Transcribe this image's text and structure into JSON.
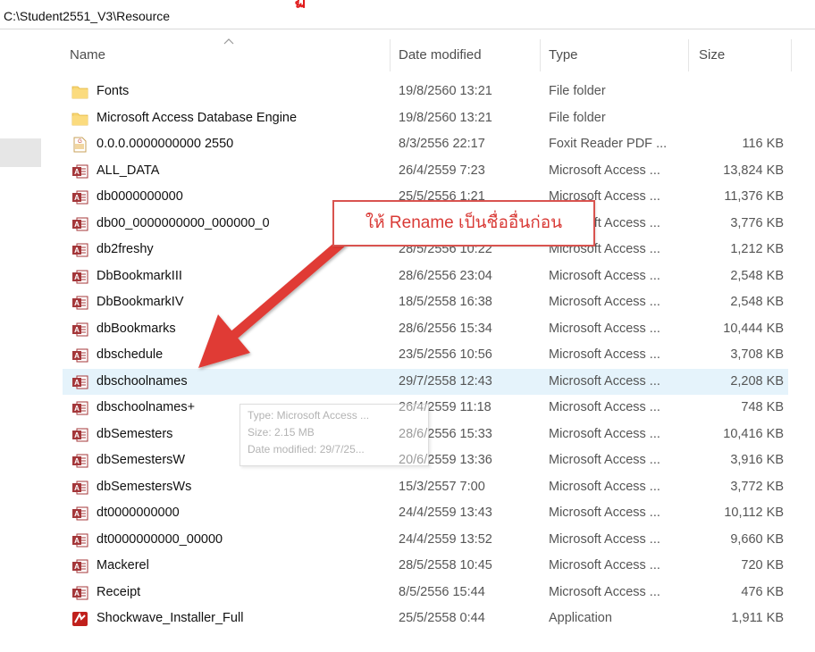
{
  "window": {
    "path": "C:\\Student2551_V3\\Resource",
    "top_red_text": "ฏ"
  },
  "columns": {
    "name": "Name",
    "date": "Date modified",
    "type": "Type",
    "size": "Size"
  },
  "files": [
    {
      "name": "Fonts",
      "date": "19/8/2560 13:21",
      "type": "File folder",
      "size": "",
      "icon": "folder-icon"
    },
    {
      "name": "Microsoft Access Database Engine",
      "date": "19/8/2560 13:21",
      "type": "File folder",
      "size": "",
      "icon": "folder-icon"
    },
    {
      "name": "0.0.0.0000000000 2550",
      "date": "8/3/2556 22:17",
      "type": "Foxit Reader PDF ...",
      "size": "116 KB",
      "icon": "pdf-icon"
    },
    {
      "name": "ALL_DATA",
      "date": "26/4/2559 7:23",
      "type": "Microsoft Access ...",
      "size": "13,824 KB",
      "icon": "access-icon"
    },
    {
      "name": "db0000000000",
      "date": "25/5/2556 1:21",
      "type": "Microsoft Access ...",
      "size": "11,376 KB",
      "icon": "access-icon"
    },
    {
      "name": "db00_0000000000_000000_0",
      "date": "",
      "type": "Microsoft Access ...",
      "size": "3,776 KB",
      "icon": "access-icon"
    },
    {
      "name": "db2freshy",
      "date": "28/5/2556 10:22",
      "type": "Microsoft Access ...",
      "size": "1,212 KB",
      "icon": "access-icon"
    },
    {
      "name": "DbBookmarkIII",
      "date": "28/6/2556 23:04",
      "type": "Microsoft Access ...",
      "size": "2,548 KB",
      "icon": "access-icon"
    },
    {
      "name": "DbBookmarkIV",
      "date": "18/5/2558 16:38",
      "type": "Microsoft Access ...",
      "size": "2,548 KB",
      "icon": "access-icon"
    },
    {
      "name": "dbBookmarks",
      "date": "28/6/2556 15:34",
      "type": "Microsoft Access ...",
      "size": "10,444 KB",
      "icon": "access-icon"
    },
    {
      "name": "dbschedule",
      "date": "23/5/2556 10:56",
      "type": "Microsoft Access ...",
      "size": "3,708 KB",
      "icon": "access-icon"
    },
    {
      "name": "dbschoolnames",
      "date": "29/7/2558 12:43",
      "type": "Microsoft Access ...",
      "size": "2,208 KB",
      "icon": "access-icon",
      "selected": true
    },
    {
      "name": "dbschoolnames+",
      "date": "26/4/2559 11:18",
      "type": "Microsoft Access ...",
      "size": "748 KB",
      "icon": "access-icon"
    },
    {
      "name": "dbSemesters",
      "date": "28/6/2556 15:33",
      "type": "Microsoft Access ...",
      "size": "10,416 KB",
      "icon": "access-icon"
    },
    {
      "name": "dbSemestersW",
      "date": "20/6/2559 13:36",
      "type": "Microsoft Access ...",
      "size": "3,916 KB",
      "icon": "access-icon"
    },
    {
      "name": "dbSemestersWs",
      "date": "15/3/2557 7:00",
      "type": "Microsoft Access ...",
      "size": "3,772 KB",
      "icon": "access-icon"
    },
    {
      "name": "dt0000000000",
      "date": "24/4/2559 13:43",
      "type": "Microsoft Access ...",
      "size": "10,112 KB",
      "icon": "access-icon"
    },
    {
      "name": "dt0000000000_00000",
      "date": "24/4/2559 13:52",
      "type": "Microsoft Access ...",
      "size": "9,660 KB",
      "icon": "access-icon"
    },
    {
      "name": "Mackerel",
      "date": "28/5/2558 10:45",
      "type": "Microsoft Access ...",
      "size": "720 KB",
      "icon": "access-icon"
    },
    {
      "name": "Receipt",
      "date": "8/5/2556 15:44",
      "type": "Microsoft Access ...",
      "size": "476 KB",
      "icon": "access-icon"
    },
    {
      "name": "Shockwave_Installer_Full",
      "date": "25/5/2558 0:44",
      "type": "Application",
      "size": "1,911 KB",
      "icon": "shockwave-icon"
    }
  ],
  "tooltip": {
    "line1": "Type: Microsoft Access ...",
    "line2": "Size: 2.15 MB",
    "line3": "Date modified: 29/7/25..."
  },
  "callout": {
    "text": "ให้ Rename เป็นชื่ออื่นก่อน"
  },
  "colors": {
    "selection": "#e5f3fb",
    "folder": "#f8d775",
    "access": "#a4373a",
    "callout_border": "#d9534f",
    "arrow": "#e03b36"
  }
}
